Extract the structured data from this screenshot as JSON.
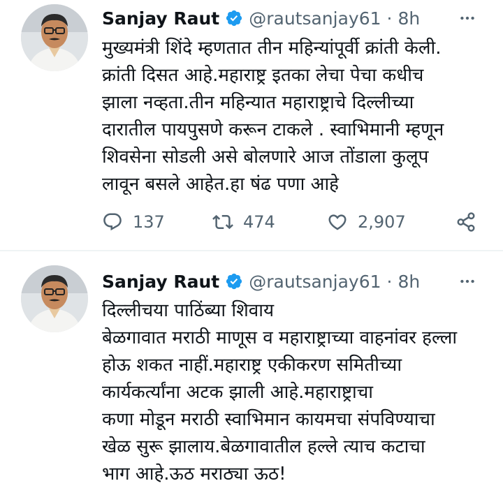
{
  "tweets": [
    {
      "author_name": "Sanjay Raut",
      "handle": "@rautsanjay61",
      "separator": "·",
      "time": "8h",
      "verified_icon": "verified-badge-icon",
      "text": "मुख्यमंत्री शिंदे म्हणतात  तीन महिन्यांपूर्वी क्रांती केली.\nक्रांती दिसत आहे.महाराष्ट्र इतका लेचा पेचा कधीच\nझाला नव्हता.तीन महिन्यात महाराष्ट्राचे दिल्लीच्या\nदारातील पायपुसणे करून टाकले .  स्वाभिमानी म्हणून\nशिवसेना सोडली असे बोलणारे आज तोंडाला कुलूप\nलावून बसले आहेत.हा षंढ पणा आहे",
      "replies": "137",
      "retweets": "474",
      "likes": "2,907"
    },
    {
      "author_name": "Sanjay Raut",
      "handle": "@rautsanjay61",
      "separator": "·",
      "time": "8h",
      "verified_icon": "verified-badge-icon",
      "text": "दिल्लीचया पाठिंब्या शिवाय\nबेळगावात मराठी माणूस व महाराष्ट्राच्या वाहनांवर हल्ला\nहोऊ शकत नाहीं.महाराष्ट्र एकीकरण समितीच्या\nकार्यकर्त्यांना अटक झाली आहे.महाराष्ट्राचा\n कणा मोडून मराठी स्वाभिमान कायमचा संपविण्याचा\nखेळ सुरू झालाय.बेळगावातील हल्ले  त्याच कटाचा\nभाग आहे.ऊठ मराठ्या ऊठ!"
    }
  ],
  "colors": {
    "text": "#0f1419",
    "secondary": "#536471",
    "verified": "#1d9bf0",
    "divider": "#eff3f4"
  }
}
